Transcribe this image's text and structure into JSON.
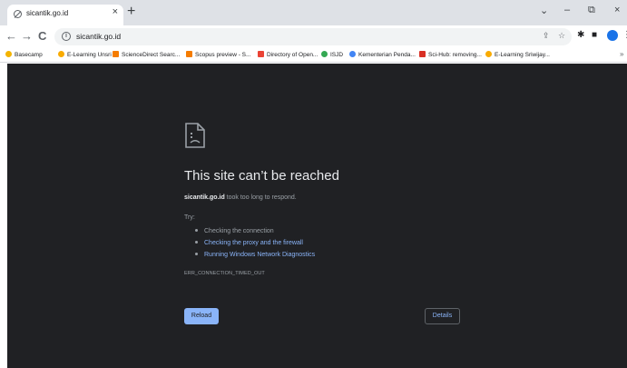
{
  "tab": {
    "title": "sicantik.go.id",
    "close": "×"
  },
  "new_tab": "+",
  "window_controls": {
    "dropdown": "⌄",
    "minimize": "–",
    "restore": "⧉",
    "close": "×"
  },
  "address_bar": {
    "url": "sicantik.go.id"
  },
  "bookmarks": [
    {
      "label": "Basecamp",
      "icon_color": "#f4b400"
    },
    {
      "label": "E-Learning Unsri",
      "icon_color": "#f9ab00"
    },
    {
      "label": "ScienceDirect Searc...",
      "icon_color": "#f57c00"
    },
    {
      "label": "Scopus preview - S...",
      "icon_color": "#f57c00"
    },
    {
      "label": "Directory of Open...",
      "icon_color": "#ea4335"
    },
    {
      "label": "ISJD",
      "icon_color": "#34a853"
    },
    {
      "label": "Kementerian Penda...",
      "icon_color": "#4285f4"
    },
    {
      "label": "Sci-Hub: removing...",
      "icon_color": "#d93025"
    },
    {
      "label": "E-Learning Sriwijay...",
      "icon_color": "#f9ab00"
    }
  ],
  "bookmarks_more": "»",
  "profile_initial": "",
  "error": {
    "title": "This site can’t be reached",
    "host": "sicantik.go.id",
    "desc_rest": " took too long to respond.",
    "try": "Try:",
    "suggestions": [
      {
        "text": "Checking the connection",
        "link": false
      },
      {
        "text": "Checking the proxy and the firewall",
        "link": true
      },
      {
        "text": "Running Windows Network Diagnostics",
        "link": true
      }
    ],
    "code": "ERR_CONNECTION_TIMED_OUT",
    "reload": "Reload",
    "details": "Details"
  },
  "colors": {
    "page_bg": "#202124",
    "link": "#8ab4f8",
    "title": "#e8eaed",
    "muted": "#9aa0a6"
  }
}
